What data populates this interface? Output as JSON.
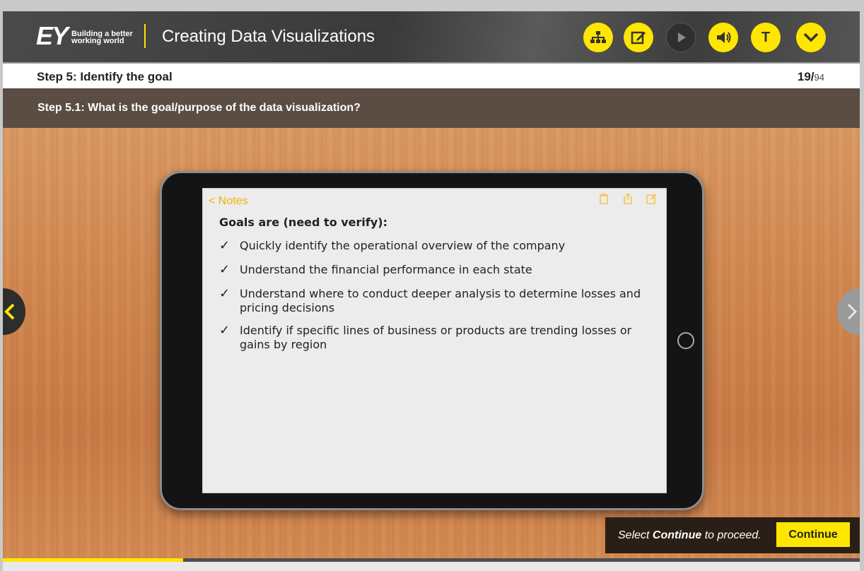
{
  "header": {
    "logo_mark": "EY",
    "logo_tagline": "Building a better working world",
    "course_title": "Creating Data Visualizations",
    "buttons": [
      {
        "name": "sitemap-icon"
      },
      {
        "name": "notes-edit-icon"
      },
      {
        "name": "play-icon"
      },
      {
        "name": "volume-icon"
      },
      {
        "name": "transcript-icon",
        "label": "T"
      },
      {
        "name": "chevron-down-icon"
      }
    ]
  },
  "step": {
    "title": "Step 5: Identify the goal",
    "current_page": "19/",
    "total_pages": "94"
  },
  "substep": {
    "title": "Step 5.1: What is the goal/purpose of the data visualization?"
  },
  "notes": {
    "back_label": "< Notes",
    "heading": "Goals are (need to verify):",
    "check_glyph": "✓",
    "goals": [
      "Quickly identify the operational overview of the company",
      "Understand the financial performance in each state",
      "Understand where to conduct deeper analysis to determine losses and pricing decisions",
      "Identify if specific lines of business or products are trending losses or gains by region"
    ]
  },
  "footer": {
    "continue_prefix": "Select ",
    "continue_bold": "Continue",
    "continue_suffix": " to proceed.",
    "continue_button": "Continue",
    "progress": 0.21
  },
  "colors": {
    "accent": "#ffe600",
    "header_bg": "#3a3a3a",
    "subbar_bg": "#5b4d44"
  }
}
